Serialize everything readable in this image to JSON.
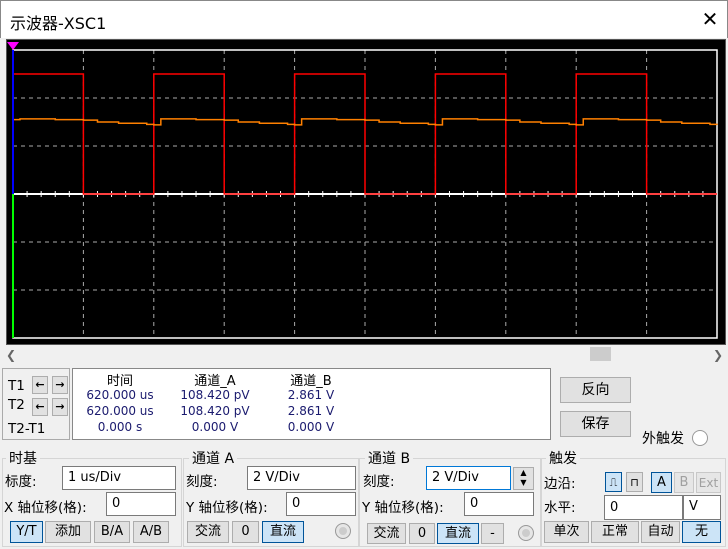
{
  "window": {
    "title": "示波器-XSC1",
    "close_icon": "close-x-icon"
  },
  "colors": {
    "channel_a": "#ff0000",
    "channel_b": "#ff8000",
    "grid": "#aaaaaa",
    "screen_bg": "#000000"
  },
  "chart_data": {
    "type": "line",
    "xlabel": "",
    "ylabel": "",
    "x_divisions": 10,
    "y_divisions": 6,
    "time_per_div_us": 1,
    "volts_per_div": 2,
    "xlim_us": [
      0,
      10
    ],
    "ylim_v": [
      -6,
      6
    ],
    "grid": true,
    "series": [
      {
        "channel": "A",
        "color": "#ff0000",
        "x": [
          0,
          0,
          1,
          1,
          2,
          2,
          3,
          3,
          4,
          4,
          5,
          5,
          6,
          6,
          7,
          7,
          8,
          8,
          9,
          9,
          10
        ],
        "y": [
          0,
          5,
          5,
          0,
          0,
          5,
          5,
          0,
          0,
          5,
          5,
          0,
          0,
          5,
          5,
          0,
          0,
          5,
          5,
          0,
          0
        ]
      },
      {
        "channel": "B",
        "color": "#ff8000",
        "x": [
          0,
          0.1,
          0.6,
          1.0,
          1.2,
          1.5,
          1.9,
          2.0,
          2.1,
          2.6,
          3.0,
          3.2,
          3.5,
          3.9,
          4.0,
          4.1,
          4.6,
          5.0,
          5.2,
          5.5,
          5.9,
          6.0,
          6.1,
          6.6,
          7.0,
          7.2,
          7.5,
          7.9,
          8.0,
          8.1,
          8.6,
          9.0,
          9.2,
          9.5,
          9.9,
          10
        ],
        "y": [
          3.1,
          3.13,
          3.1,
          3.08,
          3.0,
          2.95,
          2.9,
          2.88,
          3.13,
          3.1,
          3.08,
          3.0,
          2.95,
          2.9,
          2.88,
          3.13,
          3.1,
          3.08,
          3.0,
          2.95,
          2.9,
          2.88,
          3.13,
          3.1,
          3.08,
          3.0,
          2.95,
          2.9,
          2.88,
          3.13,
          3.1,
          3.08,
          3.0,
          2.95,
          2.9,
          2.88
        ]
      }
    ]
  },
  "cursors": {
    "t1": "T1",
    "t2": "T2",
    "diff": "T2-T1",
    "headers": [
      "时间",
      "通道_A",
      "通道_B"
    ],
    "rows": [
      [
        "620.000 us",
        "108.420 pV",
        "2.861 V"
      ],
      [
        "620.000 us",
        "108.420 pV",
        "2.861 V"
      ],
      [
        "0.000 s",
        "0.000 V",
        "0.000 V"
      ]
    ]
  },
  "buttons": {
    "reverse": "反向",
    "save": "保存",
    "ext_trigger": "外触发"
  },
  "timebase": {
    "title": "时基",
    "scale_label": "标度:",
    "scale": "1 us/Div",
    "xpos_label": "X 轴位移(格):",
    "xpos": "0",
    "modes": [
      "Y/T",
      "添加",
      "B/A",
      "A/B"
    ],
    "active_mode": "Y/T"
  },
  "channel_a": {
    "title": "通道 A",
    "scale_label": "刻度:",
    "scale": "2  V/Div",
    "ypos_label": "Y 轴位移(格):",
    "ypos": "0",
    "coupling": [
      "交流",
      "0",
      "直流"
    ],
    "active": "直流"
  },
  "channel_b": {
    "title": "通道 B",
    "scale_label": "刻度:",
    "scale": "2  V/Div",
    "ypos_label": "Y 轴位移(格):",
    "ypos": "0",
    "coupling": [
      "交流",
      "0",
      "直流",
      "-"
    ],
    "active": "直流"
  },
  "trigger": {
    "title": "触发",
    "edge_label": "边沿:",
    "sources": [
      "A",
      "B",
      "Ext"
    ],
    "active_source": "A",
    "level_label": "水平:",
    "level": "0",
    "level_unit": "V",
    "modes": [
      "单次",
      "正常",
      "自动",
      "无"
    ],
    "active_mode": "无"
  }
}
